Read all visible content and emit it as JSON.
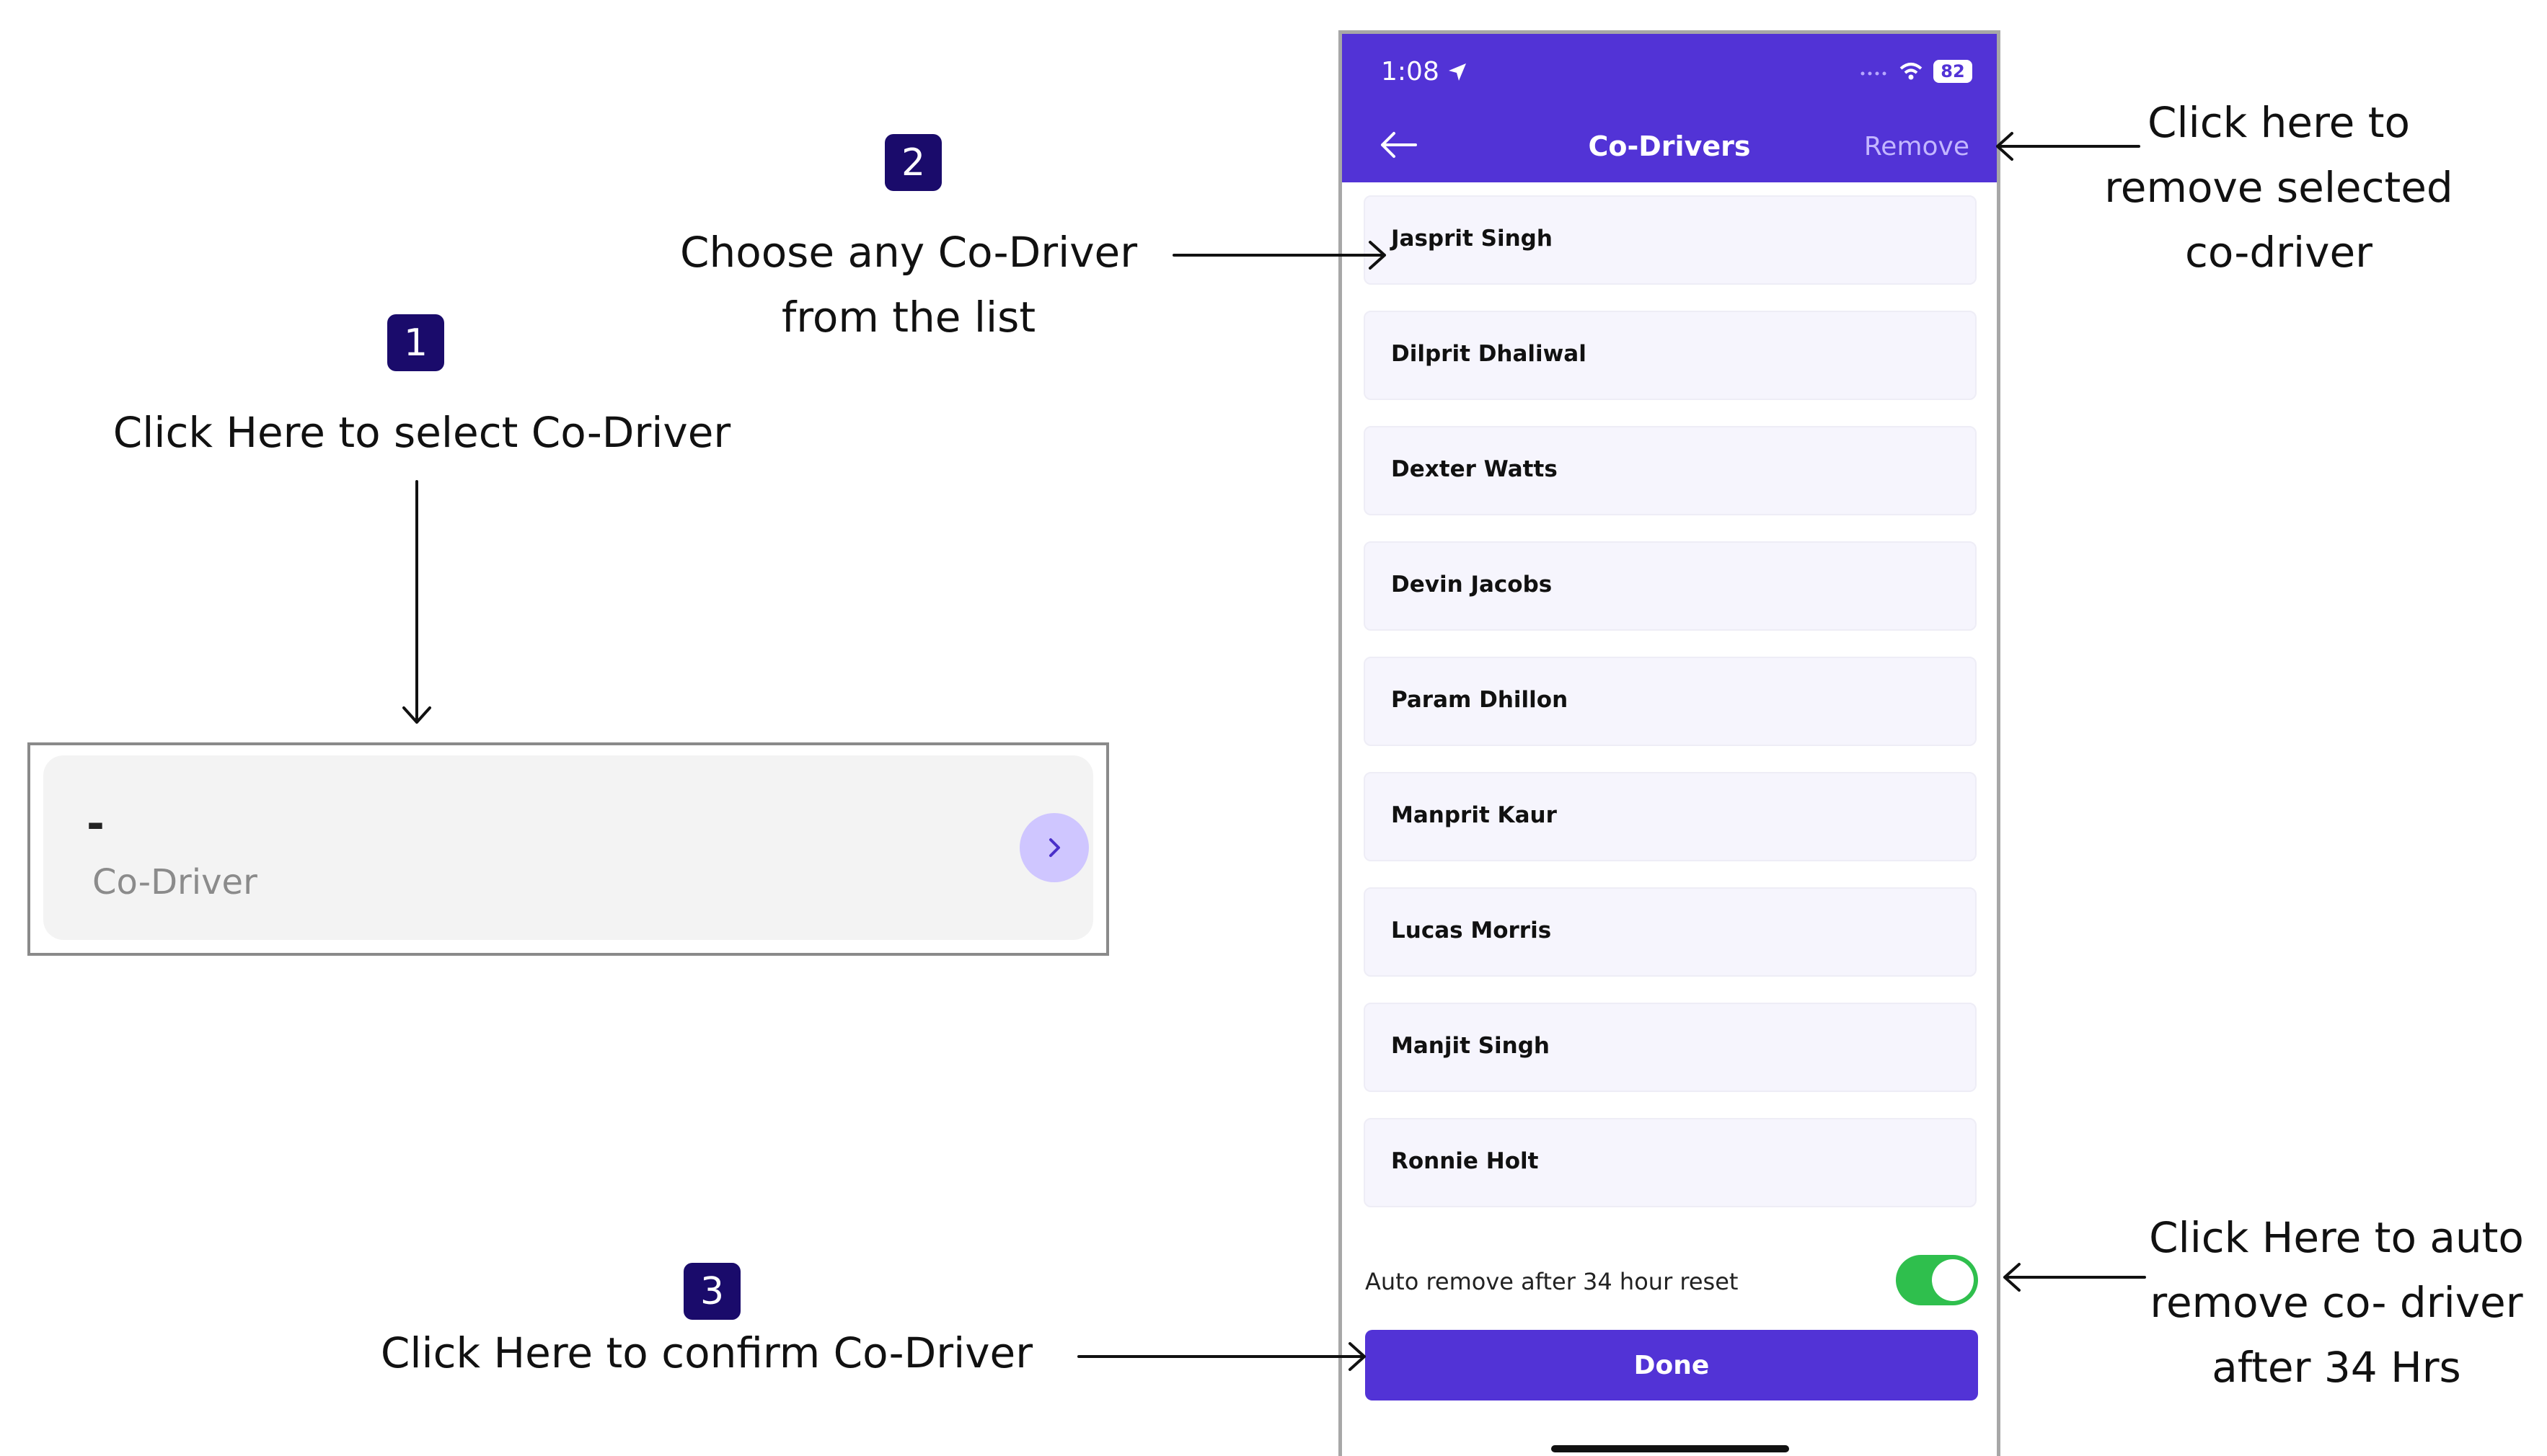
{
  "steps": {
    "step1": {
      "number": "1",
      "text": "Click Here to select Co-Driver"
    },
    "step2": {
      "number": "2",
      "line1": "Choose any Co-Driver",
      "line2": "from the list"
    },
    "step3": {
      "number": "3",
      "text": "Click Here to confirm Co-Driver"
    }
  },
  "notes": {
    "remove": {
      "line1": "Click here to",
      "line2": "remove selected",
      "line3": "co-driver"
    },
    "auto_remove": {
      "line1": "Click Here to auto",
      "line2": "remove co- driver",
      "line3": "after 34 Hrs"
    }
  },
  "card": {
    "value": "-",
    "label": "Co-Driver",
    "icon": "chevron-right-icon"
  },
  "phone": {
    "status": {
      "time": "1:08",
      "battery": "82"
    },
    "header": {
      "title": "Co-Drivers",
      "remove_label": "Remove",
      "back_icon": "arrow-left-icon"
    },
    "drivers": [
      "Jasprit Singh",
      "Dilprit Dhaliwal",
      "Dexter Watts",
      "Devin Jacobs",
      "Param Dhillon",
      "Manprit Kaur",
      "Lucas Morris",
      "Manjit Singh",
      "Ronnie Holt"
    ],
    "auto_remove_label": "Auto remove after 34 hour reset",
    "auto_remove_on": true,
    "done_label": "Done"
  },
  "colors": {
    "accent": "#5233d6",
    "badge": "#1a0b6b",
    "toggle_on": "#2fbf4d"
  }
}
